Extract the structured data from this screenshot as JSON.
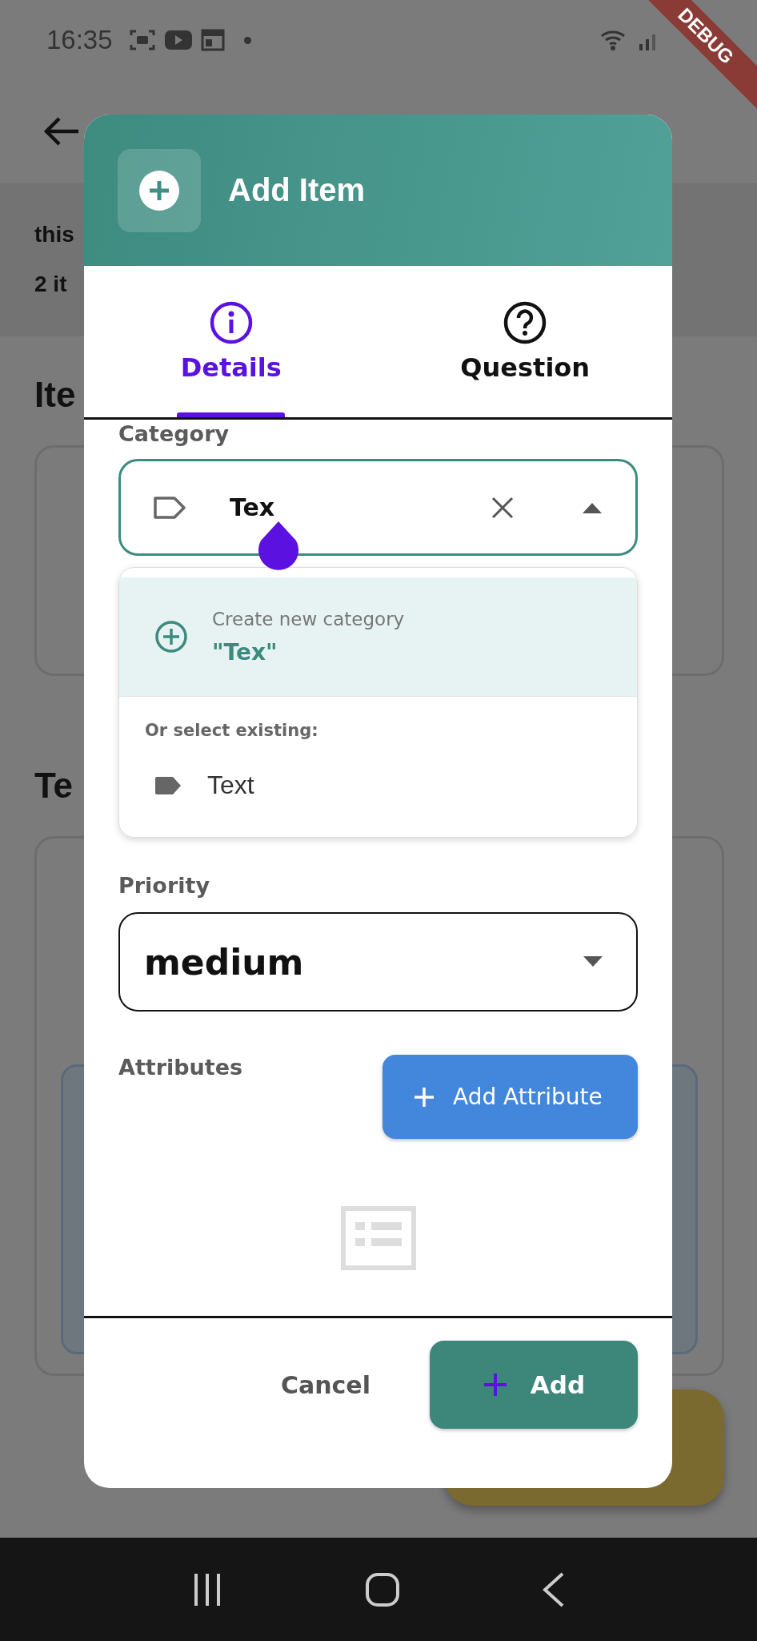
{
  "status_bar": {
    "time": "16:35"
  },
  "debug_banner": "DEBUG",
  "header": {
    "lines": [
      "this",
      "2 it"
    ]
  },
  "sections": [
    {
      "heading": "Ite"
    },
    {
      "heading": "Te"
    }
  ],
  "dialog": {
    "title": "Add Item",
    "tabs": [
      {
        "label": "Details",
        "selected": true
      },
      {
        "label": "Question",
        "selected": false
      }
    ],
    "category": {
      "label": "Category",
      "value": "Tex",
      "expanded": true
    },
    "dropdown": {
      "create": {
        "caption": "Create new category",
        "value": "\"Tex\""
      },
      "section_label": "Or select existing:",
      "options": [
        {
          "label": "Text"
        }
      ]
    },
    "priority": {
      "label": "Priority",
      "value": "medium"
    },
    "attributes": {
      "label": "Attributes",
      "button": "Add Attribute"
    },
    "buttons": {
      "cancel": "Cancel",
      "add": "Add"
    }
  }
}
